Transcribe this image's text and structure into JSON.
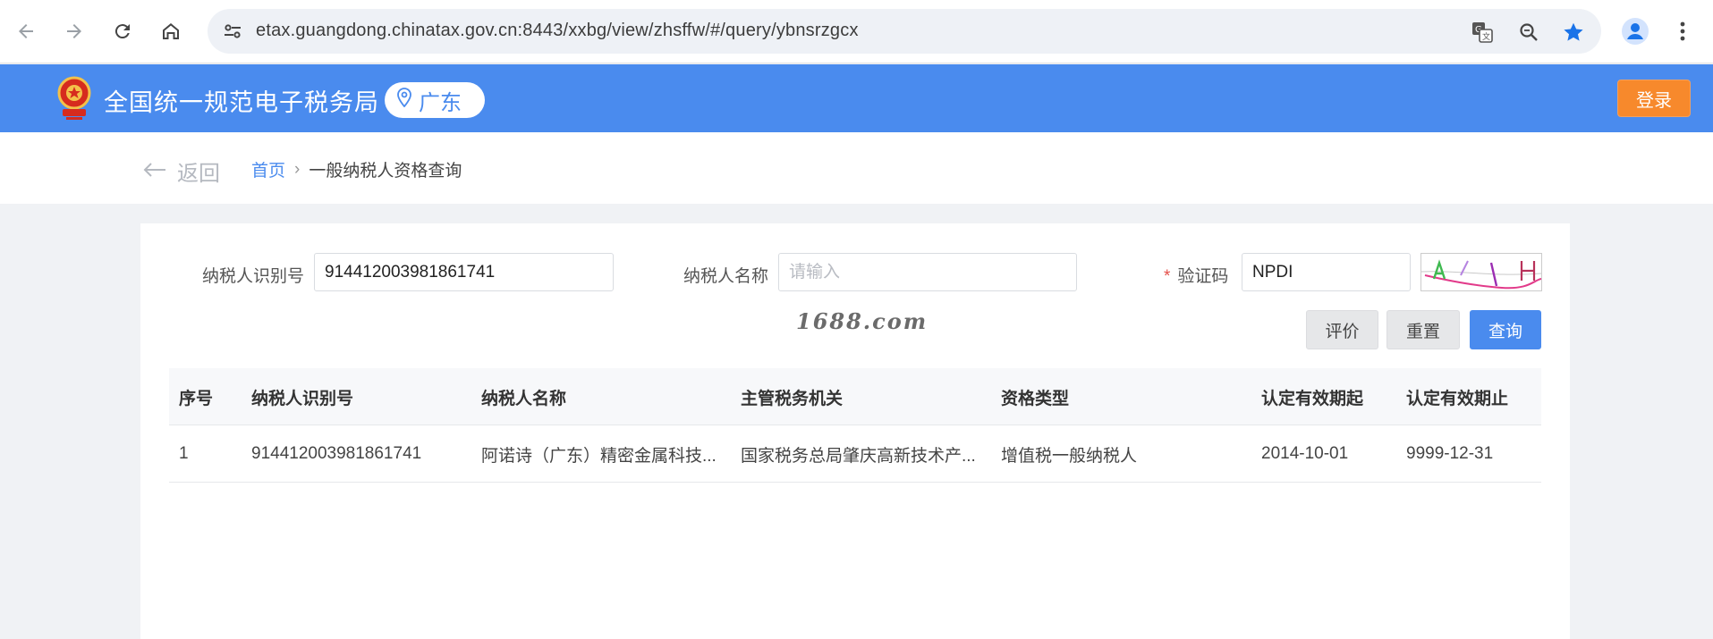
{
  "browser": {
    "url": "etax.guangdong.chinatax.gov.cn:8443/xxbg/view/zhsffw/#/query/ybnsrzgcx",
    "icons": {
      "back": "back-arrow-icon",
      "forward": "forward-arrow-icon",
      "reload": "reload-icon",
      "home": "home-icon",
      "site_settings": "tune-icon",
      "translate": "translate-icon",
      "zoom": "zoom-icon",
      "bookmark": "star-icon",
      "profile": "person-icon",
      "menu": "kebab-icon"
    },
    "accent": "#1a73e8"
  },
  "header": {
    "title": "全国统一规范电子税务局",
    "region": "广东",
    "login_label": "登录",
    "bg_color": "#4a8bee",
    "login_color": "#f7892c"
  },
  "breadcrumb": {
    "back_label": "返回",
    "home": "首页",
    "separator": "›",
    "current": "一般纳税人资格查询"
  },
  "form": {
    "taxpayer_id_label": "纳税人识别号",
    "taxpayer_id_value": "914412003981861741",
    "taxpayer_name_label": "纳税人名称",
    "taxpayer_name_placeholder": "请输入",
    "captcha_required_mark": "*",
    "captcha_label": "验证码",
    "captcha_value": "NPDI"
  },
  "watermark": "1688.com",
  "buttons": {
    "evaluate": "评价",
    "reset": "重置",
    "query": "查询"
  },
  "table": {
    "headers": [
      "序号",
      "纳税人识别号",
      "纳税人名称",
      "主管税务机关",
      "资格类型",
      "认定有效期起",
      "认定有效期止"
    ],
    "rows": [
      [
        "1",
        "914412003981861741",
        "阿诺诗（广东）精密金属科技...",
        "国家税务总局肇庆高新技术产...",
        "增值税一般纳税人",
        "2014-10-01",
        "9999-12-31"
      ]
    ]
  }
}
